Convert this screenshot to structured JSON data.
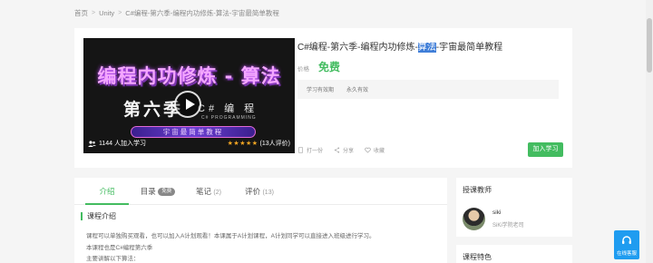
{
  "breadcrumb": {
    "items": [
      "首页",
      "Unity",
      "C#编程-第六季-编程内功修炼-算法-宇宙最简单教程"
    ],
    "separator": ">"
  },
  "course": {
    "title_before": "C#编程-第六季-编程内功修炼-",
    "title_highlight": "算法",
    "title_after": "-宇宙最简单教程",
    "price_label": "价格",
    "price": "免费",
    "meta": [
      "学习有效期",
      "永久有效"
    ],
    "cover": {
      "title_art": "编程内功修炼 - 算法",
      "season_art": "第六季",
      "season_sub": "C# 编 程",
      "art_small": "C# PROGRAMMING",
      "banner": "宇宙最简单教程",
      "learners": "1144 人加入学习",
      "stars": "★★★★★",
      "reviews": "(13人评价)"
    },
    "actions": {
      "share_label": "分享",
      "favorite_label": "收藏",
      "extra_label": "打一份"
    },
    "join_label": "加入学习"
  },
  "tabs": [
    {
      "label": "介绍",
      "count": ""
    },
    {
      "label": "目录",
      "pill": "免费"
    },
    {
      "label": "笔记",
      "count": "(2)"
    },
    {
      "label": "评价",
      "count": "(13)"
    }
  ],
  "intro": {
    "section_title": "课程介绍",
    "lines": [
      "课程可以单独购买观看，也可以加入A计划观看！本课属于A计划课程，A计划同学可以直接进入班级进行学习。",
      "本课程也是C#编程第六季",
      "主要讲解以下算法："
    ]
  },
  "teacher": {
    "section_title": "授课教师",
    "name": "siki",
    "role": "SiKi学院老司"
  },
  "features": {
    "section_title": "课程特色"
  },
  "help": {
    "label": "在线客服"
  },
  "colors": {
    "accent": "#43bc60",
    "highlight": "#3f7ed8",
    "help": "#1f9cf0",
    "star": "#f5a623"
  }
}
